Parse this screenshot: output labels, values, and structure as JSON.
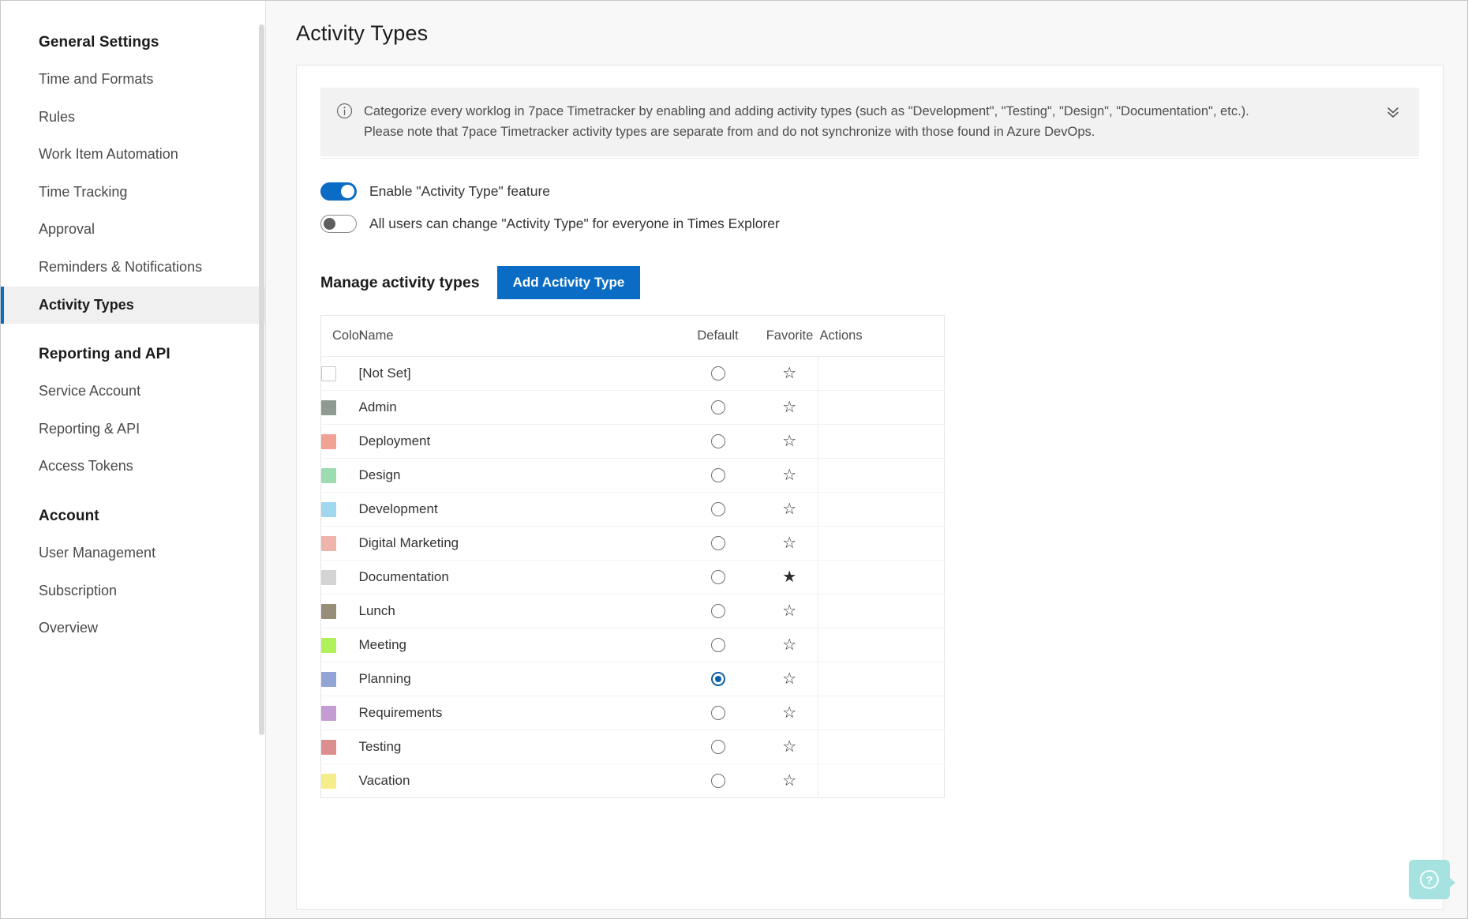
{
  "sidebar": {
    "groups": [
      {
        "title": "General Settings",
        "items": [
          {
            "label": "Time and Formats",
            "active": false
          },
          {
            "label": "Rules",
            "active": false
          },
          {
            "label": "Work Item Automation",
            "active": false
          },
          {
            "label": "Time Tracking",
            "active": false
          },
          {
            "label": "Approval",
            "active": false
          },
          {
            "label": "Reminders & Notifications",
            "active": false
          },
          {
            "label": "Activity Types",
            "active": true
          }
        ]
      },
      {
        "title": "Reporting and API",
        "items": [
          {
            "label": "Service Account",
            "active": false
          },
          {
            "label": "Reporting & API",
            "active": false
          },
          {
            "label": "Access Tokens",
            "active": false
          }
        ]
      },
      {
        "title": "Account",
        "items": [
          {
            "label": "User Management",
            "active": false
          },
          {
            "label": "Subscription",
            "active": false
          },
          {
            "label": "Overview",
            "active": false
          }
        ]
      }
    ]
  },
  "page": {
    "title": "Activity Types"
  },
  "banner": {
    "icon": "info-circle-icon",
    "text": "Categorize every worklog in 7pace Timetracker by enabling and adding activity types (such as \"Development\", \"Testing\", \"Design\", \"Documentation\", etc.). Please note that 7pace Timetracker activity types are separate from and do not synchronize with those found in Azure DevOps.",
    "collapse_icon": "double-chevron-down-icon"
  },
  "toggles": [
    {
      "label": "Enable \"Activity Type\" feature",
      "on": true,
      "name": "enable-activity-type-toggle"
    },
    {
      "label": "All users can change \"Activity Type\" for everyone in Times Explorer",
      "on": false,
      "name": "all-users-change-activity-type-toggle"
    }
  ],
  "manage": {
    "heading": "Manage activity types",
    "add_button": "Add Activity Type"
  },
  "table": {
    "columns": [
      "Color",
      "Name",
      "Default",
      "Favorite",
      "Actions"
    ],
    "rows": [
      {
        "color": "",
        "name": "[Not Set]",
        "default": false,
        "favorite": false
      },
      {
        "color": "#8f9a91",
        "name": "Admin",
        "default": false,
        "favorite": false
      },
      {
        "color": "#f0a294",
        "name": "Deployment",
        "default": false,
        "favorite": false
      },
      {
        "color": "#9ddcb0",
        "name": "Design",
        "default": false,
        "favorite": false
      },
      {
        "color": "#a1d8f0",
        "name": "Development",
        "default": false,
        "favorite": false
      },
      {
        "color": "#eeb3ab",
        "name": "Digital Marketing",
        "default": false,
        "favorite": false
      },
      {
        "color": "#d4d4d4",
        "name": "Documentation",
        "default": false,
        "favorite": true
      },
      {
        "color": "#978d79",
        "name": "Lunch",
        "default": false,
        "favorite": false
      },
      {
        "color": "#b0f05a",
        "name": "Meeting",
        "default": false,
        "favorite": false
      },
      {
        "color": "#92a4d6",
        "name": "Planning",
        "default": true,
        "favorite": false
      },
      {
        "color": "#c49bd3",
        "name": "Requirements",
        "default": false,
        "favorite": false
      },
      {
        "color": "#dc8f8f",
        "name": "Testing",
        "default": false,
        "favorite": false
      },
      {
        "color": "#f5ed8a",
        "name": "Vacation",
        "default": false,
        "favorite": false
      }
    ]
  },
  "help": {
    "label": "?",
    "icon": "question-mark-circle-icon"
  },
  "colors": {
    "accent": "#0a6cc4",
    "help_widget": "#a6e3e0"
  },
  "glyphs": {
    "star_filled": "★",
    "star_hollow": "☆"
  }
}
